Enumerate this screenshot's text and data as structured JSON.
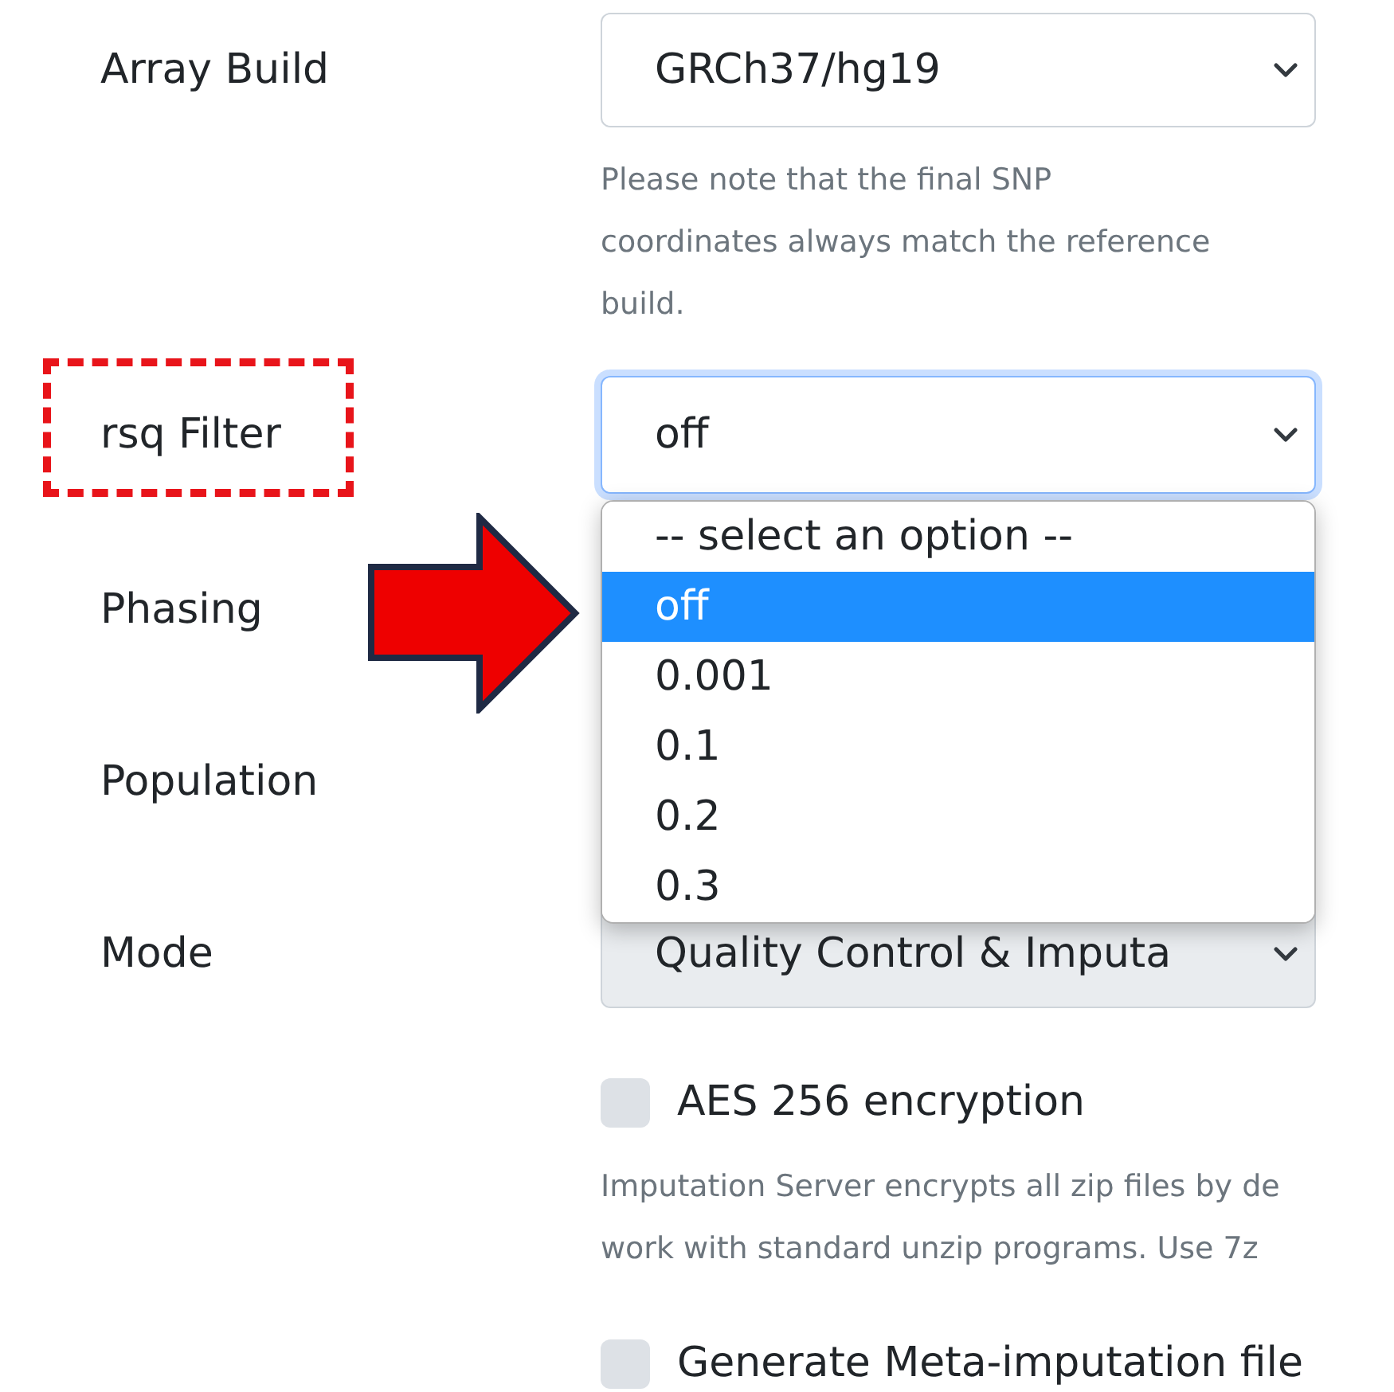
{
  "fields": [
    {
      "label": "Array Build",
      "value": "GRCh37/hg19",
      "disabled": false,
      "focused": false,
      "help": [
        "Please note that the final SNP",
        "coordinates always match the reference",
        "build."
      ]
    },
    {
      "label": "rsq Filter",
      "value": "off",
      "disabled": false,
      "focused": true,
      "annotated": true,
      "options": [
        {
          "label": "-- select an option --",
          "selected": false
        },
        {
          "label": "off",
          "selected": true
        },
        {
          "label": "0.001",
          "selected": false
        },
        {
          "label": "0.1",
          "selected": false
        },
        {
          "label": "0.2",
          "selected": false
        },
        {
          "label": "0.3",
          "selected": false
        }
      ]
    },
    {
      "label": "Phasing"
    },
    {
      "label": "Population"
    },
    {
      "label": "Mode",
      "value": "Quality Control & Imputa",
      "disabled": true,
      "focused": false
    }
  ],
  "checkboxes": [
    {
      "label": "AES 256 encryption",
      "checked": false,
      "help": [
        "Imputation Server encrypts all zip files by de",
        "work with standard unzip programs. Use 7z"
      ]
    },
    {
      "label": "Generate Meta-imputation file",
      "checked": false
    }
  ]
}
